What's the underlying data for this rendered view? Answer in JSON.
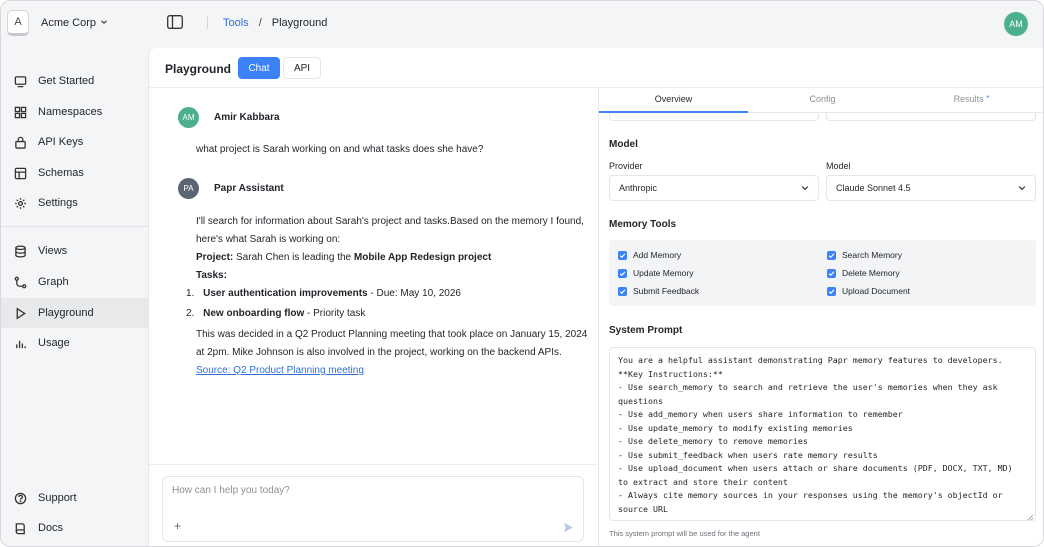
{
  "org": {
    "initial": "A",
    "name": "Acme Corp"
  },
  "sidebar": {
    "items": [
      {
        "label": "Get Started",
        "icon": "monitor-icon"
      },
      {
        "label": "Namespaces",
        "icon": "grid-icon"
      },
      {
        "label": "API Keys",
        "icon": "lock-icon"
      },
      {
        "label": "Schemas",
        "icon": "table-icon"
      },
      {
        "label": "Settings",
        "icon": "gear-icon"
      },
      {
        "label": "Views",
        "icon": "database-icon"
      },
      {
        "label": "Graph",
        "icon": "graph-icon"
      },
      {
        "label": "Playground",
        "icon": "play-icon"
      },
      {
        "label": "Usage",
        "icon": "bar-chart-icon"
      }
    ],
    "footer": [
      {
        "label": "Support",
        "icon": "help-icon"
      },
      {
        "label": "Docs",
        "icon": "book-icon"
      }
    ]
  },
  "breadcrumb": {
    "link": "Tools",
    "separator": "/",
    "current": "Playground"
  },
  "user": {
    "initials": "AM"
  },
  "page": {
    "title": "Playground",
    "tabs": {
      "chat": "Chat",
      "api": "API"
    }
  },
  "chat": {
    "user_message": {
      "initials": "AM",
      "name": "Amir Kabbara",
      "text": "what project is Sarah working on and what tasks does she have?"
    },
    "assistant_message": {
      "initials": "PA",
      "name": "Papr Assistant",
      "intro_line1": "I'll search for information about Sarah's project and tasks.Based on the memory I found,",
      "intro_line2": "here's what Sarah is working on:",
      "project_label": "Project:",
      "project_text_pre": " Sarah Chen is leading the ",
      "project_name": "Mobile App Redesign project",
      "tasks_label": "Tasks:",
      "tasks": [
        {
          "num": "1.",
          "title": "User authentication improvements",
          "detail": " - Due: May 10, 2026"
        },
        {
          "num": "2.",
          "title": "New onboarding flow",
          "detail": " - Priority task"
        }
      ],
      "closing_line1": "This was decided in a Q2 Product Planning meeting that took place on January 15, 2024",
      "closing_line2": "at 2pm. Mike Johnson is also involved in the project, working on the backend APIs.",
      "source_link": "Source: Q2 Product Planning meeting"
    },
    "input": {
      "placeholder": "How can I help you today?",
      "plus": "+"
    }
  },
  "right_tabs": {
    "overview": "Overview",
    "config": "Config",
    "results": "Results",
    "results_marker": "*"
  },
  "model": {
    "section_title": "Model",
    "provider_label": "Provider",
    "provider_value": "Anthropic",
    "model_label": "Model",
    "model_value": "Claude Sonnet 4.5"
  },
  "memory_tools": {
    "section_title": "Memory Tools",
    "items": [
      {
        "label": "Add Memory",
        "checked": true
      },
      {
        "label": "Search Memory",
        "checked": true
      },
      {
        "label": "Update Memory",
        "checked": true
      },
      {
        "label": "Delete Memory",
        "checked": true
      },
      {
        "label": "Submit Feedback",
        "checked": true
      },
      {
        "label": "Upload Document",
        "checked": true
      }
    ]
  },
  "system_prompt": {
    "section_title": "System Prompt",
    "lines": [
      "You are a helpful assistant demonstrating Papr memory features to developers.",
      "",
      "**Key Instructions:**",
      "- Use search_memory to search and retrieve the user's memories when they ask",
      "questions",
      "- Use add_memory when users share information to remember",
      "- Use update_memory to modify existing memories",
      "- Use delete_memory to remove memories",
      "- Use submit_feedback when users rate memory results",
      "- Use upload_document when users attach or share documents (PDF, DOCX, TXT, MD)",
      "to extract and store their content",
      "- Always cite memory sources in your responses using the memory's objectId or",
      "source URL"
    ],
    "help_text": "This system prompt will be used for the agent"
  },
  "colors": {
    "accent": "#3b82f6",
    "avatar_green": "#4caf8e",
    "avatar_assistant": "#5b6472",
    "link": "#2f6fd6"
  }
}
